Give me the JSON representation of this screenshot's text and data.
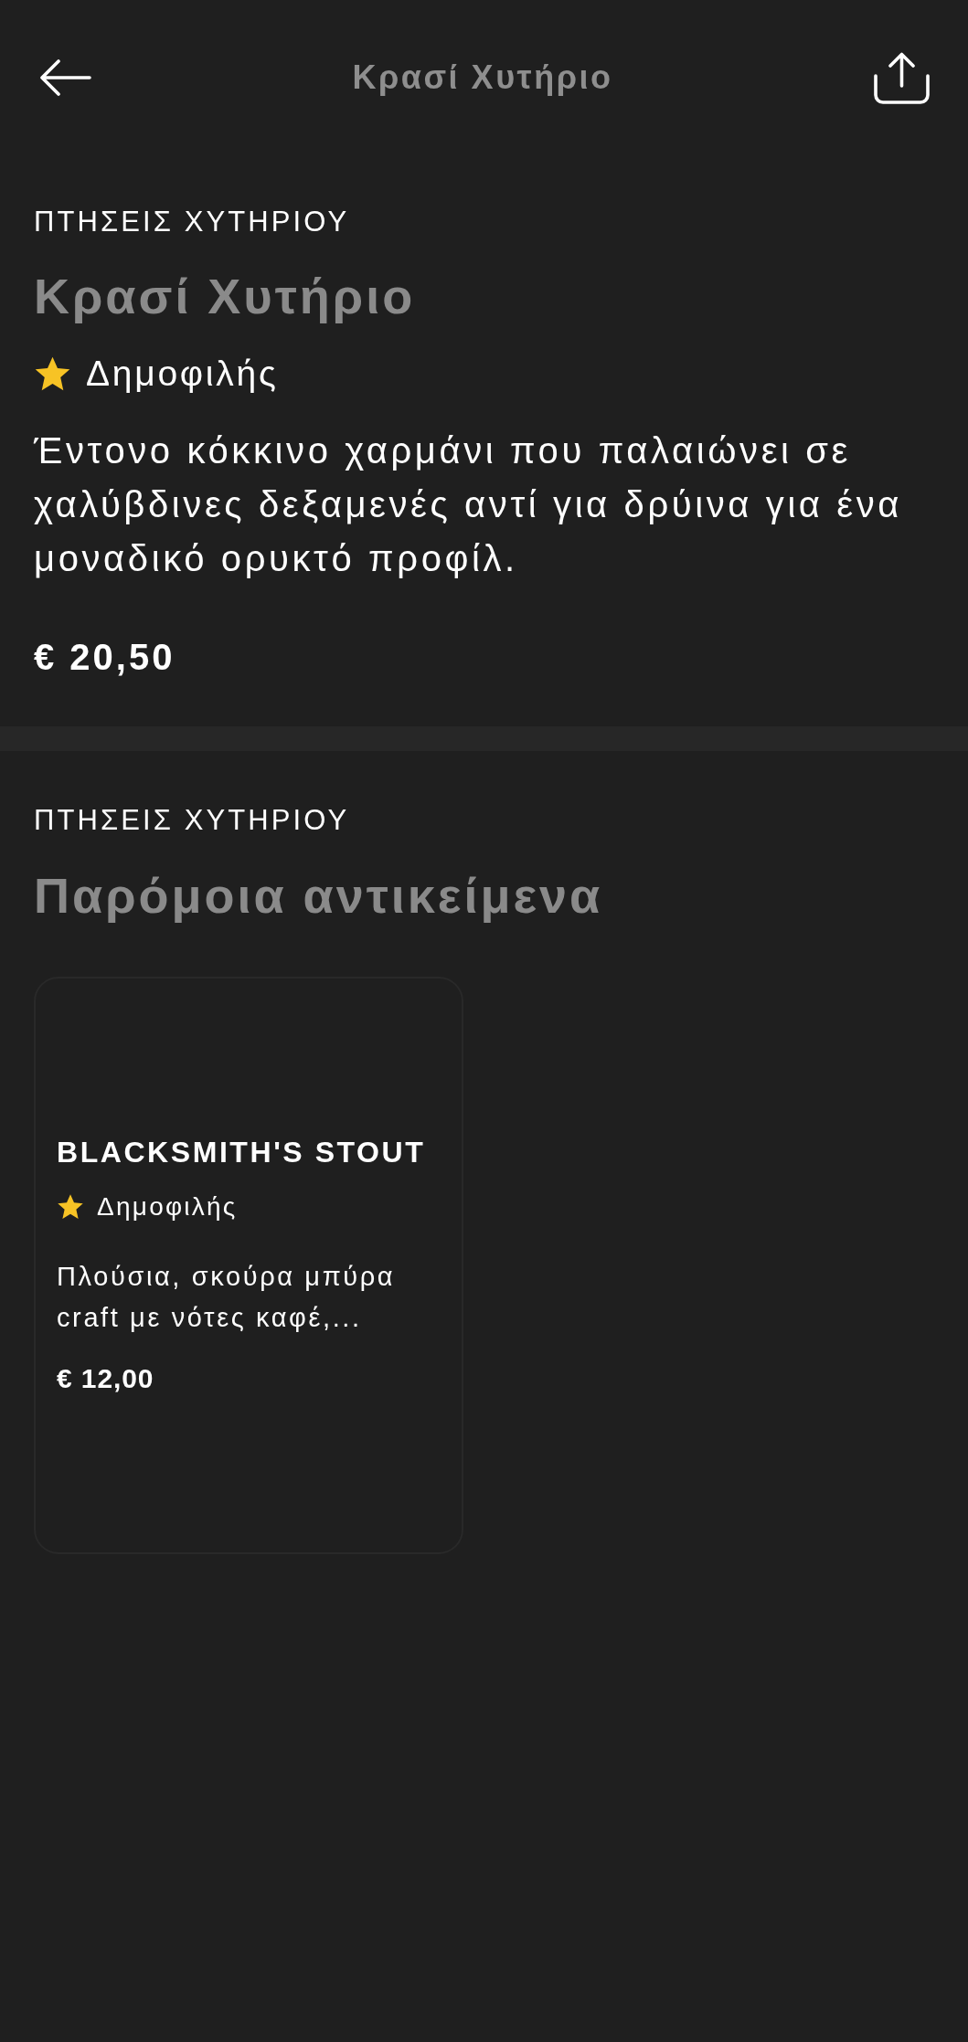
{
  "header": {
    "title": "Κρασί Χυτήριο"
  },
  "product": {
    "category": "ΠΤΗΣΕΙΣ ΧΥΤΗΡΙΟΥ",
    "name": "Κρασί Χυτήριο",
    "badge": "Δημοφιλής",
    "description": "Έντονο κόκκινο χαρμάνι που παλαιώνει σε χαλύβδινες δεξαμενές αντί για δρύινα για ένα μοναδικό ορυκτό προφίλ.",
    "price": "€ 20,50"
  },
  "similar": {
    "category": "ΠΤΗΣΕΙΣ ΧΥΤΗΡΙΟΥ",
    "title": "Παρόμοια αντικείμενα",
    "items": [
      {
        "name": "BLACKSMITH'S STOUT",
        "badge": "Δημοφιλής",
        "description": "Πλούσια, σκούρα μπύρα craft με νότες καφέ,...",
        "price": "€ 12,00"
      }
    ]
  }
}
